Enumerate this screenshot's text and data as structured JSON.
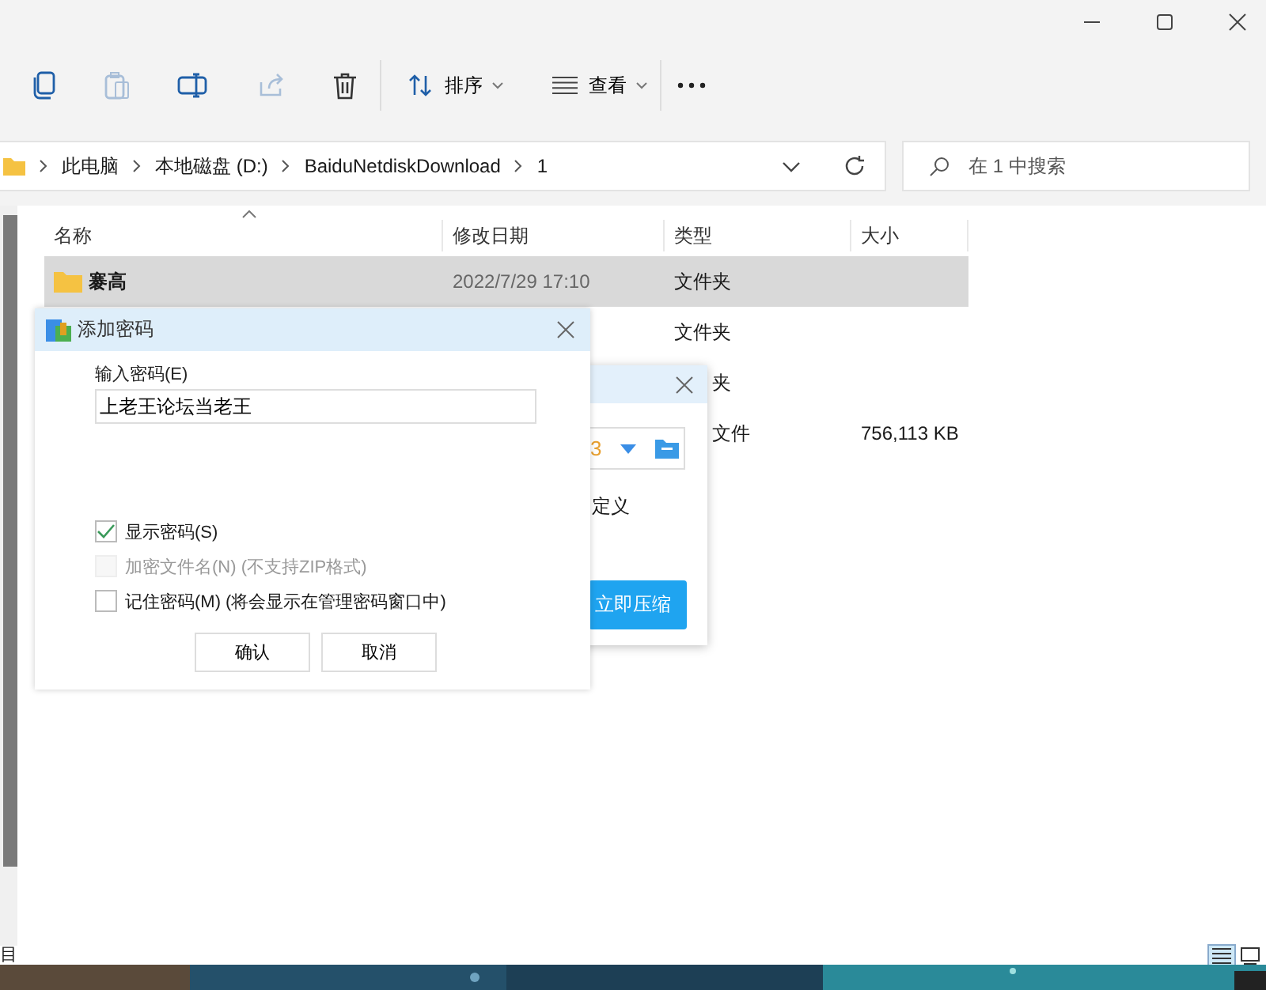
{
  "toolbar": {
    "icon_buttons": [
      {
        "kind": "copy",
        "disabled": false
      },
      {
        "kind": "paste",
        "disabled": true
      },
      {
        "kind": "rename",
        "disabled": false
      },
      {
        "kind": "share",
        "disabled": true
      },
      {
        "kind": "delete",
        "disabled": false
      }
    ],
    "menus": [
      {
        "kind": "sort",
        "label": "排序"
      },
      {
        "kind": "view",
        "label": "查看"
      }
    ]
  },
  "address": {
    "crumbs": [
      "此电脑",
      "本地磁盘 (D:)",
      "BaiduNetdiskDownload",
      "1"
    ]
  },
  "search": {
    "placeholder": "在 1 中搜索"
  },
  "table": {
    "columns": [
      "名称",
      "修改日期",
      "类型",
      "大小"
    ],
    "rows": [
      {
        "name": "褰高",
        "date": "2022/7/29 17:10",
        "type": "文件夹",
        "size": "",
        "selected": true
      },
      {
        "name": "",
        "date": "",
        "type": "文件夹",
        "size": "",
        "selected": false
      },
      {
        "name": "",
        "date": "",
        "type": "夹",
        "size": "",
        "selected": false
      },
      {
        "name": "",
        "date": "",
        "type": "文件",
        "size": "756,113 KB",
        "selected": false
      }
    ]
  },
  "back_dialog": {
    "field_value": "3",
    "option": "定义",
    "button": "立即压缩"
  },
  "dialog": {
    "title": "添加密码",
    "label": "输入密码(E)",
    "value": "上老王论坛当老王",
    "checkboxes": [
      {
        "label": "显示密码(S)",
        "checked": true,
        "disabled": false
      },
      {
        "label": "加密文件名(N) (不支持ZIP格式)",
        "checked": false,
        "disabled": true
      },
      {
        "label": "记住密码(M) (将会显示在管理密码窗口中)",
        "checked": false,
        "disabled": false
      }
    ],
    "buttons": [
      "确认",
      "取消"
    ]
  },
  "status_bar": {
    "text": "目",
    "views": [
      {
        "kind": "details",
        "selected": true
      },
      {
        "kind": "tiles",
        "selected": false
      }
    ]
  }
}
